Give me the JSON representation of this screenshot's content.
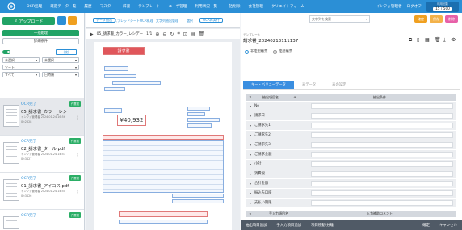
{
  "header": {
    "nav": [
      "OCR処理",
      "確定データ一覧",
      "履歴",
      "マスター",
      "辞書",
      "テンプレート",
      "ユーザ管理",
      "利用状況一覧",
      "一括削除",
      "会社管理",
      "クリエイトフォーム"
    ],
    "mode": "インフォ管理者",
    "logout": "ログオフ",
    "usage_label": "利用回数",
    "usage_value": "15 / 500"
  },
  "sidebar": {
    "upload": "アップロード",
    "collapse": "一括処理",
    "detail": "詳細条件",
    "filter_btn": "(絞)",
    "sel1": "未選択",
    "sel2": "未選択",
    "sel3": "ソート",
    "sel4": "すべて",
    "sel5": "日時順",
    "docs": [
      {
        "status": "OCR完了",
        "badge": "作業前",
        "name": "05_請求書_カラー_レシー",
        "meta1": "インフォ管理者 2024.01.24 16:56",
        "meta2": "ID:2828"
      },
      {
        "status": "OCR完了",
        "badge": "作業前",
        "name": "02_請求書_タール.pdf",
        "meta1": "インフォ管理者 2024.01.24 14:53",
        "meta2": "ID:3427"
      },
      {
        "status": "OCR完了",
        "badge": "作業前",
        "name": "01_請求書_アイコス.pdf",
        "meta1": "インフォ管理者 2024.01.24 14:50",
        "meta2": "ID:3426"
      },
      {
        "status": "OCR完了",
        "badge": "作業前",
        "name": "",
        "meta1": "",
        "meta2": ""
      }
    ]
  },
  "viewer": {
    "tab1": "データ抽出",
    "tab2": "スプレッドシート",
    "tab3": "OCR処理",
    "tab4": "文字列抽出管理",
    "tab5": "選択",
    "tab_btn": "OCR再実行",
    "filename": "05_請求書_カラー_レシデー",
    "pages": "1/1",
    "invoice_title": "請求書",
    "amount": "¥40,932"
  },
  "panel": {
    "search_placeholder": "文字列を検索",
    "b1": "確定",
    "b2": "保存",
    "b3": "削除",
    "label_small": "テンプレート",
    "title": "請求書_20240213111137",
    "radio1": "非定型帳票",
    "radio2": "定型帳票",
    "tabs": [
      "キー・バリューデータ",
      "表データ",
      "表の設定"
    ],
    "col1": "抽出項目名",
    "col2": "抽出条件",
    "rows": [
      "No",
      "請求日",
      "ご請求先1",
      "ご請求先2",
      "ご請求先3",
      "ご請求金額",
      "小計",
      "消費税",
      "合計金額",
      "振込先口座",
      "支払い期限"
    ],
    "section1": "手入力項目名",
    "section2": "入力補助コメント",
    "bottom": [
      "抽出項目追加",
      "手入力項目追加",
      "項目移動/分離",
      "確定",
      "キャンセル"
    ]
  },
  "colors": {
    "accent": "#2b8fd6",
    "green": "#21a366",
    "badge": "#2bae66"
  }
}
